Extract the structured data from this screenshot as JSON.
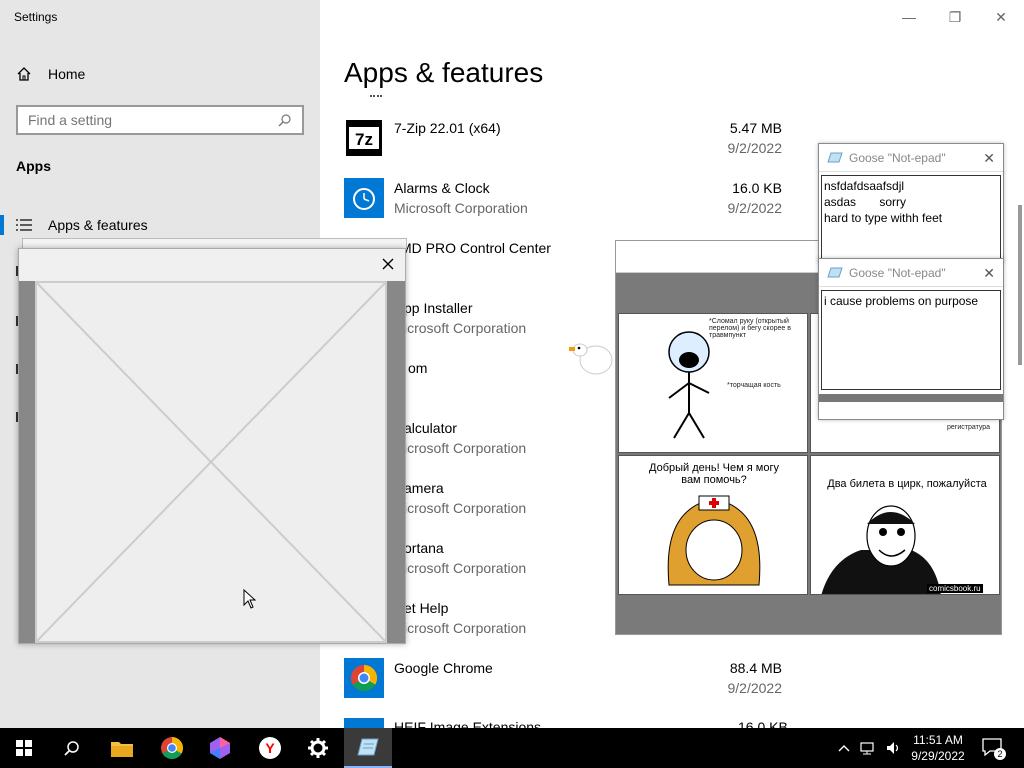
{
  "window": {
    "title": "Settings",
    "minimize": "—",
    "maximize": "❐",
    "close": "✕"
  },
  "sidebar": {
    "home_label": "Home",
    "search_placeholder": "Find a setting",
    "section": "Apps",
    "active_item": "Apps & features"
  },
  "main": {
    "title": "Apps & features",
    "apps": [
      {
        "name": "7-Zip 22.01 (x64)",
        "publisher": "",
        "size": "5.47 MB",
        "date": "9/2/2022",
        "icon": "7zip-icon"
      },
      {
        "name": "Alarms & Clock",
        "publisher": "Microsoft Corporation",
        "size": "16.0 KB",
        "date": "9/2/2022",
        "icon": "alarms-clock-icon"
      },
      {
        "name": "AMD PRO Control Center",
        "publisher": "",
        "size": "",
        "date": "",
        "icon": "amd-icon"
      },
      {
        "name": "App Installer",
        "publisher": "Microsoft Corporation",
        "size": "",
        "date": "",
        "icon": "app-installer-icon"
      },
      {
        "name": "Bloom",
        "publisher": "",
        "size": "",
        "date": "",
        "icon": "bloom-icon"
      },
      {
        "name": "Calculator",
        "publisher": "Microsoft Corporation",
        "size": "",
        "date": "",
        "icon": "calculator-icon"
      },
      {
        "name": "Camera",
        "publisher": "Microsoft Corporation",
        "size": "",
        "date": "",
        "icon": "camera-icon"
      },
      {
        "name": "Cortana",
        "publisher": "Microsoft Corporation",
        "size": "",
        "date": "",
        "icon": "cortana-icon"
      },
      {
        "name": "Get Help",
        "publisher": "Microsoft Corporation",
        "size": "",
        "date": "",
        "icon": "get-help-icon"
      },
      {
        "name": "Google Chrome",
        "publisher": "",
        "size": "88.4 MB",
        "date": "9/2/2022",
        "icon": "chrome-icon"
      },
      {
        "name": "HEIF Image Extensions",
        "publisher": "",
        "size": "16.0 KB",
        "date": "",
        "icon": "heif-icon"
      }
    ],
    "partial": {
      "amd": "MD PRO Control Center",
      "installer": "pp Installer",
      "installer_pub": "icrosoft Corporation",
      "bloom": "om",
      "calc": "alculator",
      "calc_pub": "icrosoft Corporation",
      "camera": "amera",
      "camera_pub": "icrosoft Corporation",
      "cortana": "ortana",
      "cortana_pub": "icrosoft Corporation",
      "gethelp": "et Help",
      "gethelp_pub": "icrosoft Corporation",
      "heif": "HEIF Image Extensions"
    }
  },
  "notepads": [
    {
      "title": "Goose \"Not-epad\"",
      "text": "nsfdafdsaafsdjl\nasdas       sorry\nhard to type withh feet"
    },
    {
      "title": "Goose \"Not-epad\"",
      "text": "i cause problems on purpose"
    }
  ],
  "comic": {
    "panel1_text": "*Сломал руку (открытый перелом) и бегу скорее в травмпункт",
    "panel1_sub": "*торчащая кость",
    "panel2_sub": "регистратура",
    "panel3_text": "Добрый день! Чем я могу вам помочь?",
    "panel4_text": "Два билета в цирк, пожалуйста",
    "watermark": "comicsbook.ru"
  },
  "taskbar": {
    "time": "11:51 AM",
    "date": "9/29/2022",
    "notif_count": "2"
  }
}
